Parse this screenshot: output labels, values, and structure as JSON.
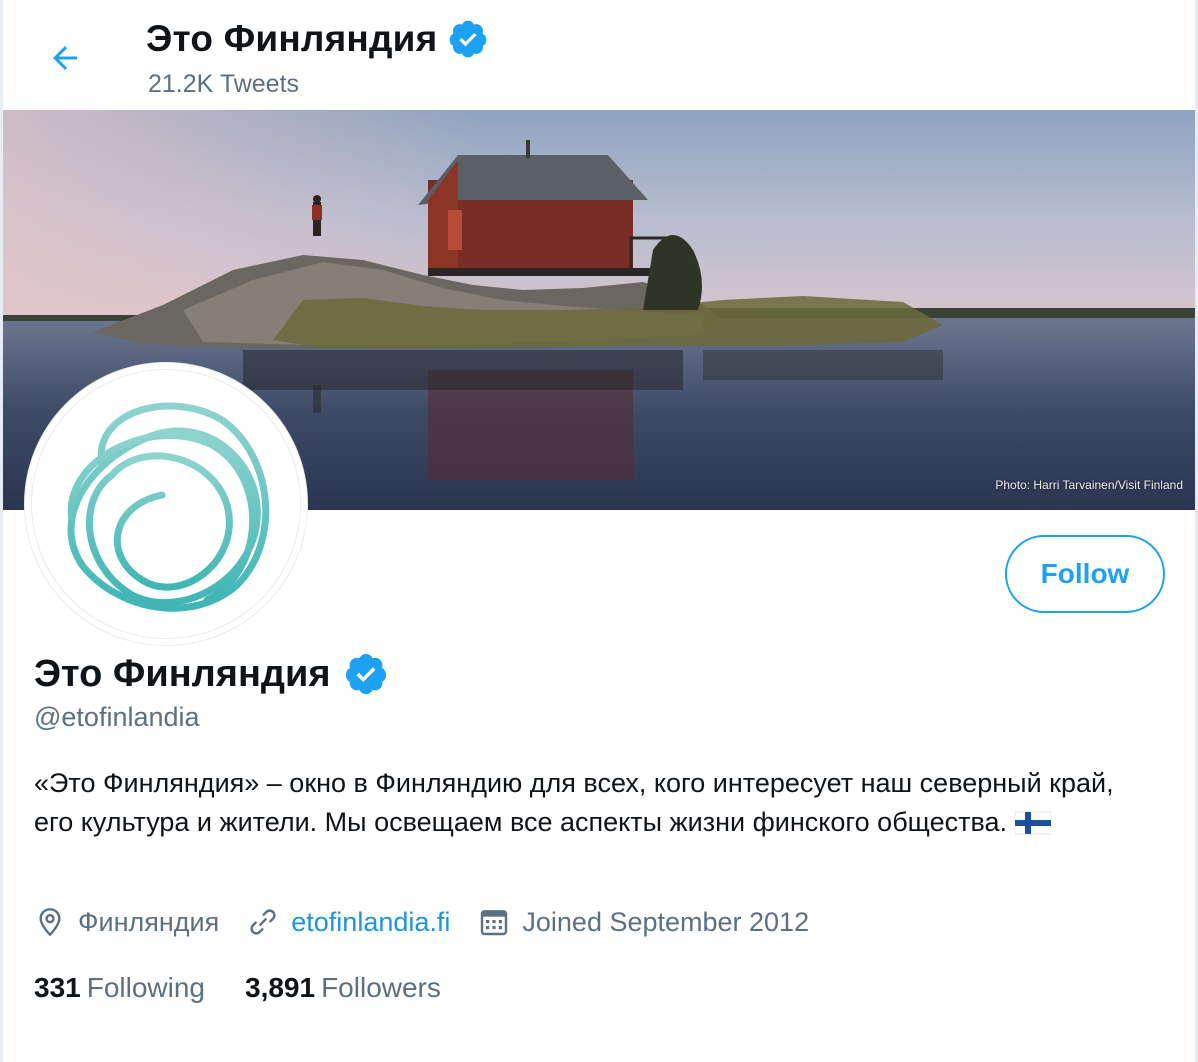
{
  "header": {
    "title": "Это Финляндия",
    "tweet_count": "21.2K Tweets"
  },
  "banner": {
    "photo_credit": "Photo: Harri Tarvainen/Visit Finland"
  },
  "profile": {
    "name": "Это Финляндия",
    "handle": "@etofinlandia",
    "bio": "«Это Финляндия» – окно в Финляндию для всех, кого интересует наш северный край, его культура и жители. Мы освещаем все аспекты жизни финского общества.",
    "location": "Финляндия",
    "website": "etofinlandia.fi",
    "joined": "Joined September 2012",
    "following_count": "331",
    "following_label": "Following",
    "followers_count": "3,891",
    "followers_label": "Followers"
  },
  "actions": {
    "follow_label": "Follow"
  },
  "icons": {
    "back": "arrow-left-icon",
    "verified": "verified-badge-icon",
    "location": "location-pin-icon",
    "link": "link-icon",
    "calendar": "calendar-icon",
    "flag": "finland-flag-icon"
  },
  "colors": {
    "accent": "#1da1f2",
    "link": "#1b95e0",
    "secondary_text": "#5b7083",
    "avatar_logo": "#5cc1bd"
  }
}
